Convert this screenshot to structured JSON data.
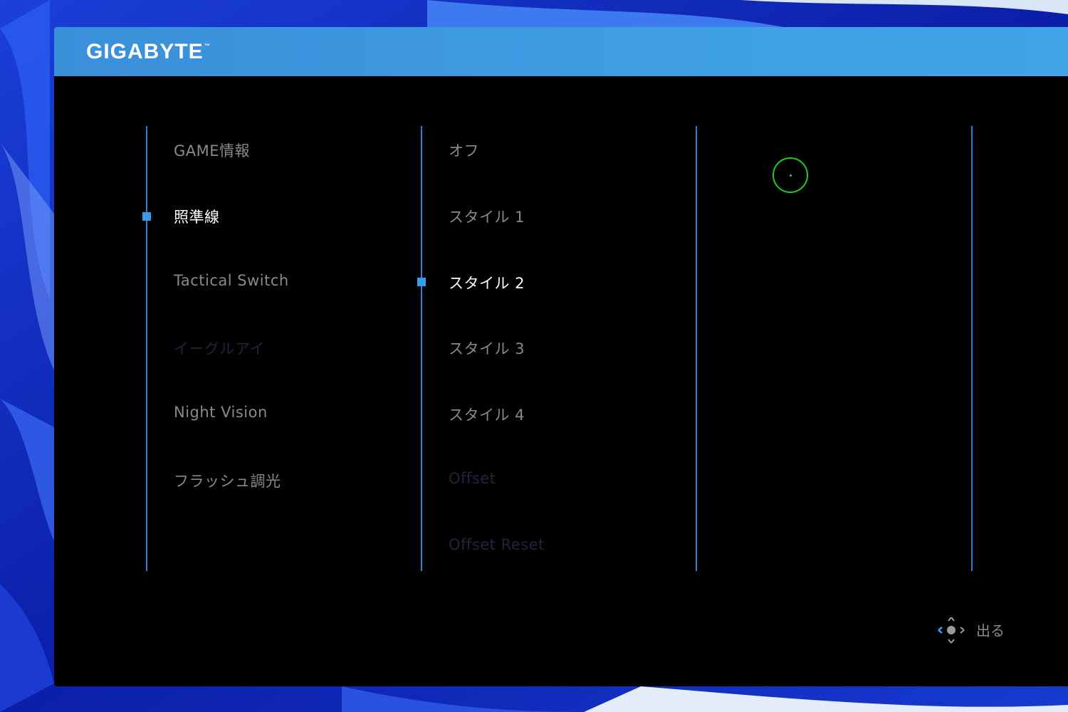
{
  "brand": {
    "logo": "GIGABYTE",
    "tm": "™"
  },
  "columns": {
    "main_menu": {
      "items": [
        {
          "label": "GAME情報",
          "state": "normal"
        },
        {
          "label": "照準線",
          "state": "selected"
        },
        {
          "label": "Tactical Switch",
          "state": "normal"
        },
        {
          "label": "イーグルアイ",
          "state": "disabled"
        },
        {
          "label": "Night Vision",
          "state": "normal"
        },
        {
          "label": "フラッシュ調光",
          "state": "normal"
        }
      ]
    },
    "sub_menu": {
      "items": [
        {
          "label": "オフ",
          "state": "normal"
        },
        {
          "label": "スタイル 1",
          "state": "normal"
        },
        {
          "label": "スタイル 2",
          "state": "selected"
        },
        {
          "label": "スタイル 3",
          "state": "normal"
        },
        {
          "label": "スタイル 4",
          "state": "normal"
        },
        {
          "label": "Offset",
          "state": "disabled"
        },
        {
          "label": "Offset Reset",
          "state": "disabled"
        }
      ]
    },
    "preview": {
      "crosshair": "circle-dot-crosshair-icon",
      "color": "#1fc92e"
    }
  },
  "footer": {
    "nav_icon": "joystick-nav-icon",
    "exit_label": "出る"
  },
  "colors": {
    "accent": "#3b9ce6",
    "header": "#3f9ee4",
    "text_normal": "#8a8a8a",
    "text_selected": "#ffffff",
    "text_disabled": "#23233a",
    "crosshair": "#1fc92e"
  }
}
